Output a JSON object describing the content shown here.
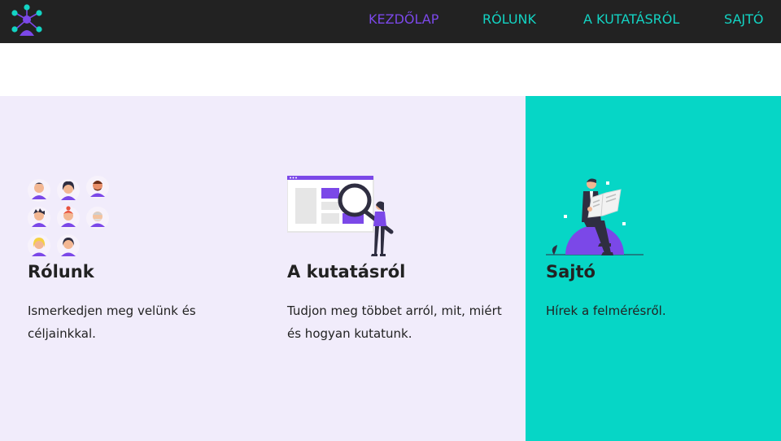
{
  "navbar": {
    "logo_icon": "network-people-icon",
    "links": [
      {
        "label": "KEZDŐLAP",
        "active": true
      },
      {
        "label": "RÓLUNK",
        "active": false
      },
      {
        "label": "A KUTATÁSRÓL",
        "active": false
      },
      {
        "label": "SAJTÓ",
        "active": false
      }
    ]
  },
  "cards": [
    {
      "illustration": "people-avatars-illustration",
      "title": "Rólunk",
      "description": "Ismerkedjen meg velünk és céljainkkal."
    },
    {
      "illustration": "magnifier-research-illustration",
      "title": "A kutatásról",
      "description": "Tudjon meg többet arról, mit, miért és hogyan kutatunk."
    },
    {
      "illustration": "man-reading-newspaper-illustration",
      "title": "Sajtó",
      "description": "Hírek a felmérésről."
    }
  ],
  "colors": {
    "navbar_bg": "#222222",
    "nav_link": "#13d3c3",
    "nav_active": "#7b48e8",
    "lavender_panel": "#f1ecfb",
    "teal_panel": "#06d6c6",
    "text": "#222222"
  }
}
